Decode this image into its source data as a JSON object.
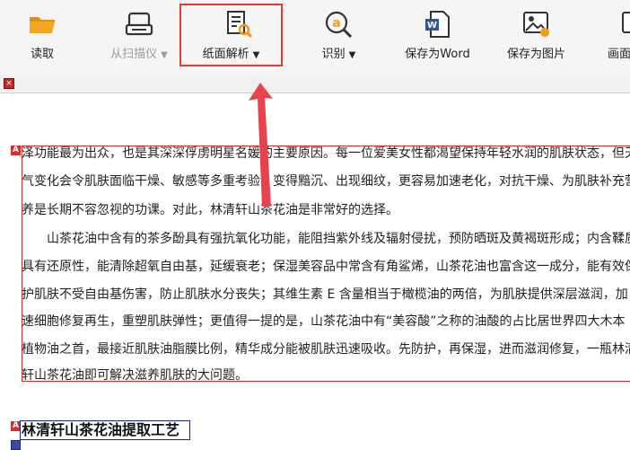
{
  "toolbar": {
    "read_label": "读取",
    "scan_label": "从扫描仪",
    "parse_label": "纸面解析",
    "recognize_label": "识别",
    "save_word_label": "保存为Word",
    "save_image_label": "保存为图片",
    "cut_label": "画面",
    "caret": "▼"
  },
  "tab": {
    "close_glyph": "×"
  },
  "document": {
    "badge": "A",
    "lines": [
      "泽功能最为出众，也是其深深俘虏明星名媛的主要原因。每一位爱美女性都渴望保持年轻水润的肌肤状态，但天",
      "气变化会令肌肤面临干燥、敏感等多重考验，变得黯沉、出现细纹，更容易加速老化，对抗干燥、为肌肤补充营",
      "养是长期不容忽视的功课。对此，林清轩山茶花油是非常好的选择。",
      "山茶花油中含有的茶多酚具有强抗氧化功能，能阻挡紫外线及辐射侵扰，预防晒斑及黄褐斑形成；内含鞣质",
      "具有还原性，能清除超氧自由基，延缓衰老；保湿美容品中常含有角鲨烯，山茶花油也富含这一成分，能有效保",
      "护肌肤不受自由基伤害，防止肌肤水分丧失；其维生素 E 含量相当于橄榄油的两倍，为肌肤提供深层滋润，加",
      "速细胞修复再生，重塑肌肤弹性；更值得一提的是，山茶花油中有“美容酸”之称的油酸的占比居世界四大木本",
      "植物油之首，最接近肌肤油脂膜比例，精华成分能被肌肤迅速吸收。先防护，再保湿，进而滋润修复，一瓶林清",
      "轩山茶花油即可解决滋养肌肤的大问题。"
    ],
    "heading": "林清轩山茶花油提取工艺"
  },
  "colors": {
    "highlight": "#e53935",
    "arrow": "#e8434c",
    "block_border": "#d32f2f",
    "heading_border": "#1a237e",
    "folder_orange": "#f5a623",
    "recognize_orange": "#f39c12",
    "word_blue": "#2b579a"
  },
  "icons": [
    "folder-icon",
    "scanner-icon",
    "document-magnify-icon",
    "recognize-icon",
    "word-icon",
    "image-icon",
    "close-icon"
  ]
}
